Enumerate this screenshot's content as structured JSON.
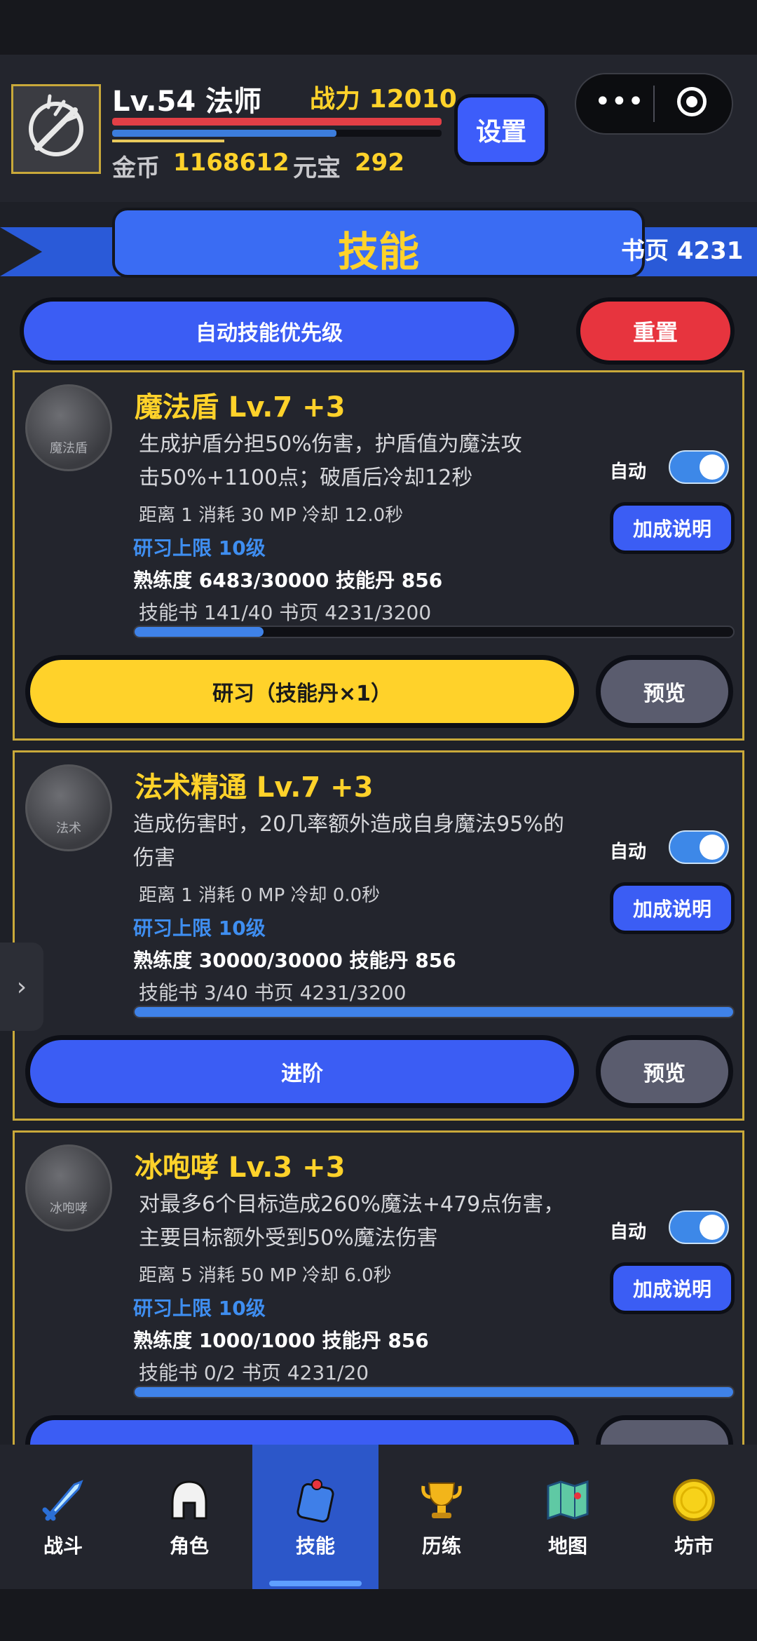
{
  "header": {
    "level_class": "Lv.54 法师",
    "power": "战力 12010",
    "gold_label": "金币",
    "gold_value": "1168612",
    "yuanbao_label": "元宝",
    "yuanbao_value": "292",
    "settings_label": "设置",
    "hp_fraction": 1.0,
    "mp_fraction": 0.68,
    "xp_fraction": 0.34
  },
  "title": {
    "text": "技能",
    "book_pages": "书页 4231"
  },
  "toolbar": {
    "auto_priority_label": "自动技能优先级",
    "reset_label": "重置"
  },
  "skills": [
    {
      "name": "魔法盾 Lv.7 +3",
      "icon_label": "魔法盾",
      "desc1": "生成护盾分担50%伤害，护盾值为魔法攻",
      "desc2": "击50%+1100点；破盾后冷却12秒",
      "stats": "距离 1  消耗 30 MP  冷却 12.0秒",
      "limit": "研习上限 10级",
      "proficiency": "熟练度 6483/30000  技能丹 856",
      "books": "技能书 141/40  书页 4231/3200",
      "progress": 0.216,
      "auto_label": "自动",
      "bonus_label": "加成说明",
      "main_button": "研习（技能丹×1）",
      "preview_label": "预览"
    },
    {
      "name": "法术精通 Lv.7 +3",
      "icon_label": "法术",
      "desc1": "造成伤害时，20几率额外造成自身魔法95%的",
      "desc2": "伤害",
      "stats": "距离 1  消耗 0 MP  冷却 0.0秒",
      "limit": "研习上限 10级",
      "proficiency": "熟练度 30000/30000  技能丹 856",
      "books": "技能书 3/40  书页 4231/3200",
      "progress": 1.0,
      "auto_label": "自动",
      "bonus_label": "加成说明",
      "main_button": "进阶",
      "preview_label": "预览"
    },
    {
      "name": "冰咆哮 Lv.3 +3",
      "icon_label": "冰咆哮",
      "desc1": "对最多6个目标造成260%魔法+479点伤害，",
      "desc2": "主要目标额外受到50%魔法伤害",
      "stats": "距离 5  消耗 50 MP  冷却 6.0秒",
      "limit": "研习上限 10级",
      "proficiency": "熟练度 1000/1000  技能丹 856",
      "books": "技能书 0/2  书页 4231/20",
      "progress": 1.0,
      "auto_label": "自动",
      "bonus_label": "加成说明"
    }
  ],
  "nav": [
    {
      "label": "战斗",
      "icon": "sword-icon"
    },
    {
      "label": "角色",
      "icon": "helmet-icon"
    },
    {
      "label": "技能",
      "icon": "skill-book-icon"
    },
    {
      "label": "历练",
      "icon": "trophy-icon"
    },
    {
      "label": "地图",
      "icon": "map-icon"
    },
    {
      "label": "坊市",
      "icon": "coin-icon"
    }
  ],
  "colors": {
    "accent_gold": "#ffd22a",
    "button_blue": "#3b5df4",
    "button_red": "#e7343e",
    "background": "#1e2027"
  }
}
